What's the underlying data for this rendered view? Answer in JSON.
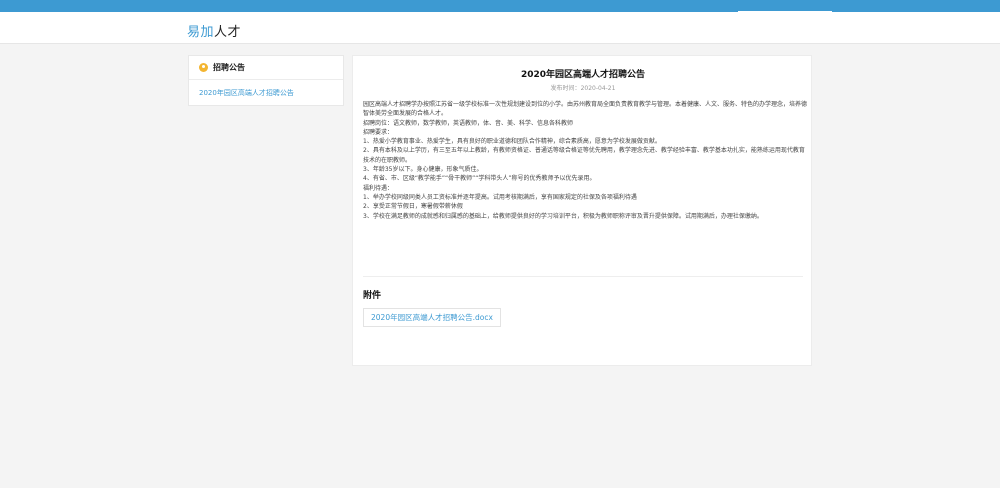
{
  "brand": {
    "part1": "易加",
    "part2": "人才"
  },
  "sidebar": {
    "heading": "招聘公告",
    "items": [
      {
        "label": "2020年园区高端人才招聘公告"
      }
    ]
  },
  "article": {
    "title": "2020年园区高端人才招聘公告",
    "date_label": "发布时间：",
    "date": "2020-04-21",
    "paragraphs": [
      "园区高端人才招聘学办按照江苏省一级学校标准一次性规划建设到位的小学。由苏州教育局全面负责教育教学与管理。本着健康、人文、服务、特色的办学理念，培养德智体美劳全面发展的合格人才。",
      "招聘岗位：语文教师，数学教师，英语教师，体、音、美、科学、信息各科教师",
      "招聘要求：",
      "  1、热爱小学教育事业、热爱学生，具有良好的职业道德和团队合作精神，综合素质高，愿意为学校发展做贡献。",
      "  2、具有本科及以上学历，有三至五年以上教龄，有教师资格证、普通话等级合格证等优先聘用，教学理念先进、教学经验丰富、教学基本功扎实，能熟练运用现代教育技术的在职教师。",
      "  3、年龄35岁以下。身心健康，形象气质佳。",
      "  4、有省、市、区级“教学能手”“骨干教师”“学科带头人”称号的优秀教师予以优先录用。",
      "福利待遇：",
      "  1、举办学校同级同类人员工资标准并逐年提高。试用考核期满后，享有国家规定的社保及各项福利待遇",
      "  2、享受正常节假日，寒暑假带薪休假",
      "  3、学校在满足教师的成就感和归属感的基础上，给教师提供良好的学习培训平台，积极为教师职称评审及晋升提供保障。试用期满后，办理社保缴纳。"
    ]
  },
  "attachments": {
    "heading": "附件",
    "files": [
      {
        "name": "2020年园区高端人才招聘公告.docx"
      }
    ]
  },
  "colors": {
    "accent": "#3d9ad2",
    "icon": "#f3b531"
  }
}
